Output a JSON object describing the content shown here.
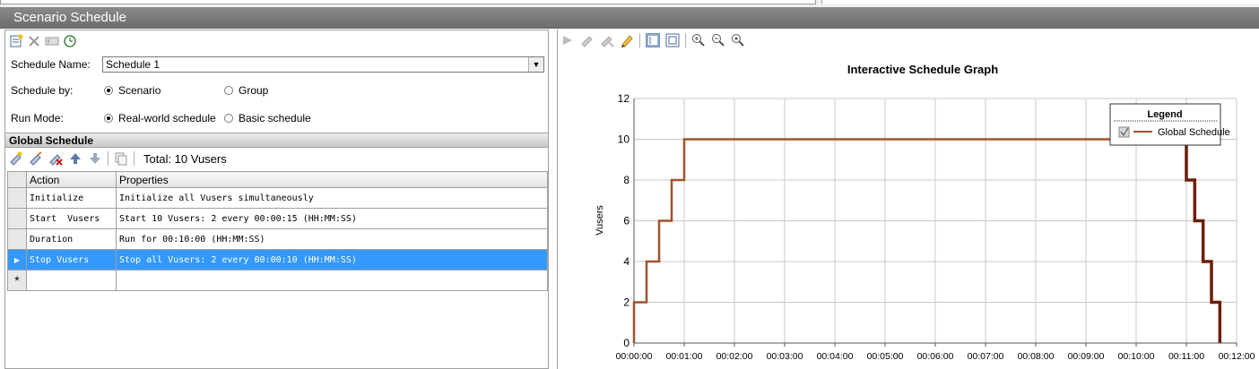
{
  "window": {
    "title": "Scenario Schedule"
  },
  "left_toolbar": {
    "icons": [
      "new-schedule-icon",
      "delete-icon",
      "rename-icon",
      "schedule-clock-icon"
    ]
  },
  "schedule": {
    "name_label": "Schedule Name:",
    "name_value": "Schedule 1",
    "by_label": "Schedule by:",
    "by_options": [
      "Scenario",
      "Group"
    ],
    "by_selected": "Scenario",
    "mode_label": "Run Mode:",
    "mode_options": [
      "Real-world schedule",
      "Basic schedule"
    ],
    "mode_selected": "Real-world schedule"
  },
  "global_schedule": {
    "header": "Global Schedule",
    "total_label": "Total: 10 Vusers",
    "columns": [
      "Action",
      "Properties"
    ],
    "rows": [
      {
        "action": "Initialize",
        "properties": "Initialize all Vusers simultaneously"
      },
      {
        "action": "Start  Vusers",
        "properties": "Start 10 Vusers: 2 every 00:00:15 (HH:MM:SS)"
      },
      {
        "action": "Duration",
        "properties": "Run for 00:10:00 (HH:MM:SS)"
      },
      {
        "action": "Stop Vusers",
        "properties": "Stop all Vusers: 2 every 00:00:10 (HH:MM:SS)"
      }
    ],
    "selected_row": 3,
    "new_row_marker": "*",
    "selected_marker": "▶"
  },
  "graph_toolbar": {
    "icons": [
      "arrow-icon",
      "edit-icon",
      "delete-icon",
      "pencil-icon",
      "view-icon",
      "fit-icon",
      "zoom-in-icon",
      "zoom-out-icon",
      "zoom-reset-icon"
    ]
  },
  "chart_data": {
    "type": "line",
    "title": "Interactive Schedule Graph",
    "ylabel": "Vusers",
    "xlabel": "",
    "ylim": [
      0,
      12
    ],
    "yticks": [
      "0",
      "2",
      "4",
      "6",
      "8",
      "10",
      "12"
    ],
    "xticks": [
      "00:00:00",
      "00:01:00",
      "00:02:00",
      "00:03:00",
      "00:04:00",
      "00:05:00",
      "00:06:00",
      "00:07:00",
      "00:08:00",
      "00:09:00",
      "00:10:00",
      "00:11:00",
      "00:12:00"
    ],
    "xlim_seconds": [
      0,
      720
    ],
    "grid": true,
    "legend_title": "Legend",
    "legend_position": "top-right",
    "series": [
      {
        "name": "Global Schedule",
        "color": "#a0522d",
        "x_seconds": [
          0,
          0,
          15,
          15,
          30,
          30,
          45,
          45,
          60,
          60,
          660,
          660,
          670,
          670,
          680,
          680,
          690,
          690,
          700,
          700
        ],
        "values": [
          0,
          2,
          2,
          4,
          4,
          6,
          6,
          8,
          8,
          10,
          10,
          8,
          8,
          6,
          6,
          4,
          4,
          2,
          2,
          0
        ]
      }
    ],
    "stop_segment_color": "#6b1f0a"
  }
}
